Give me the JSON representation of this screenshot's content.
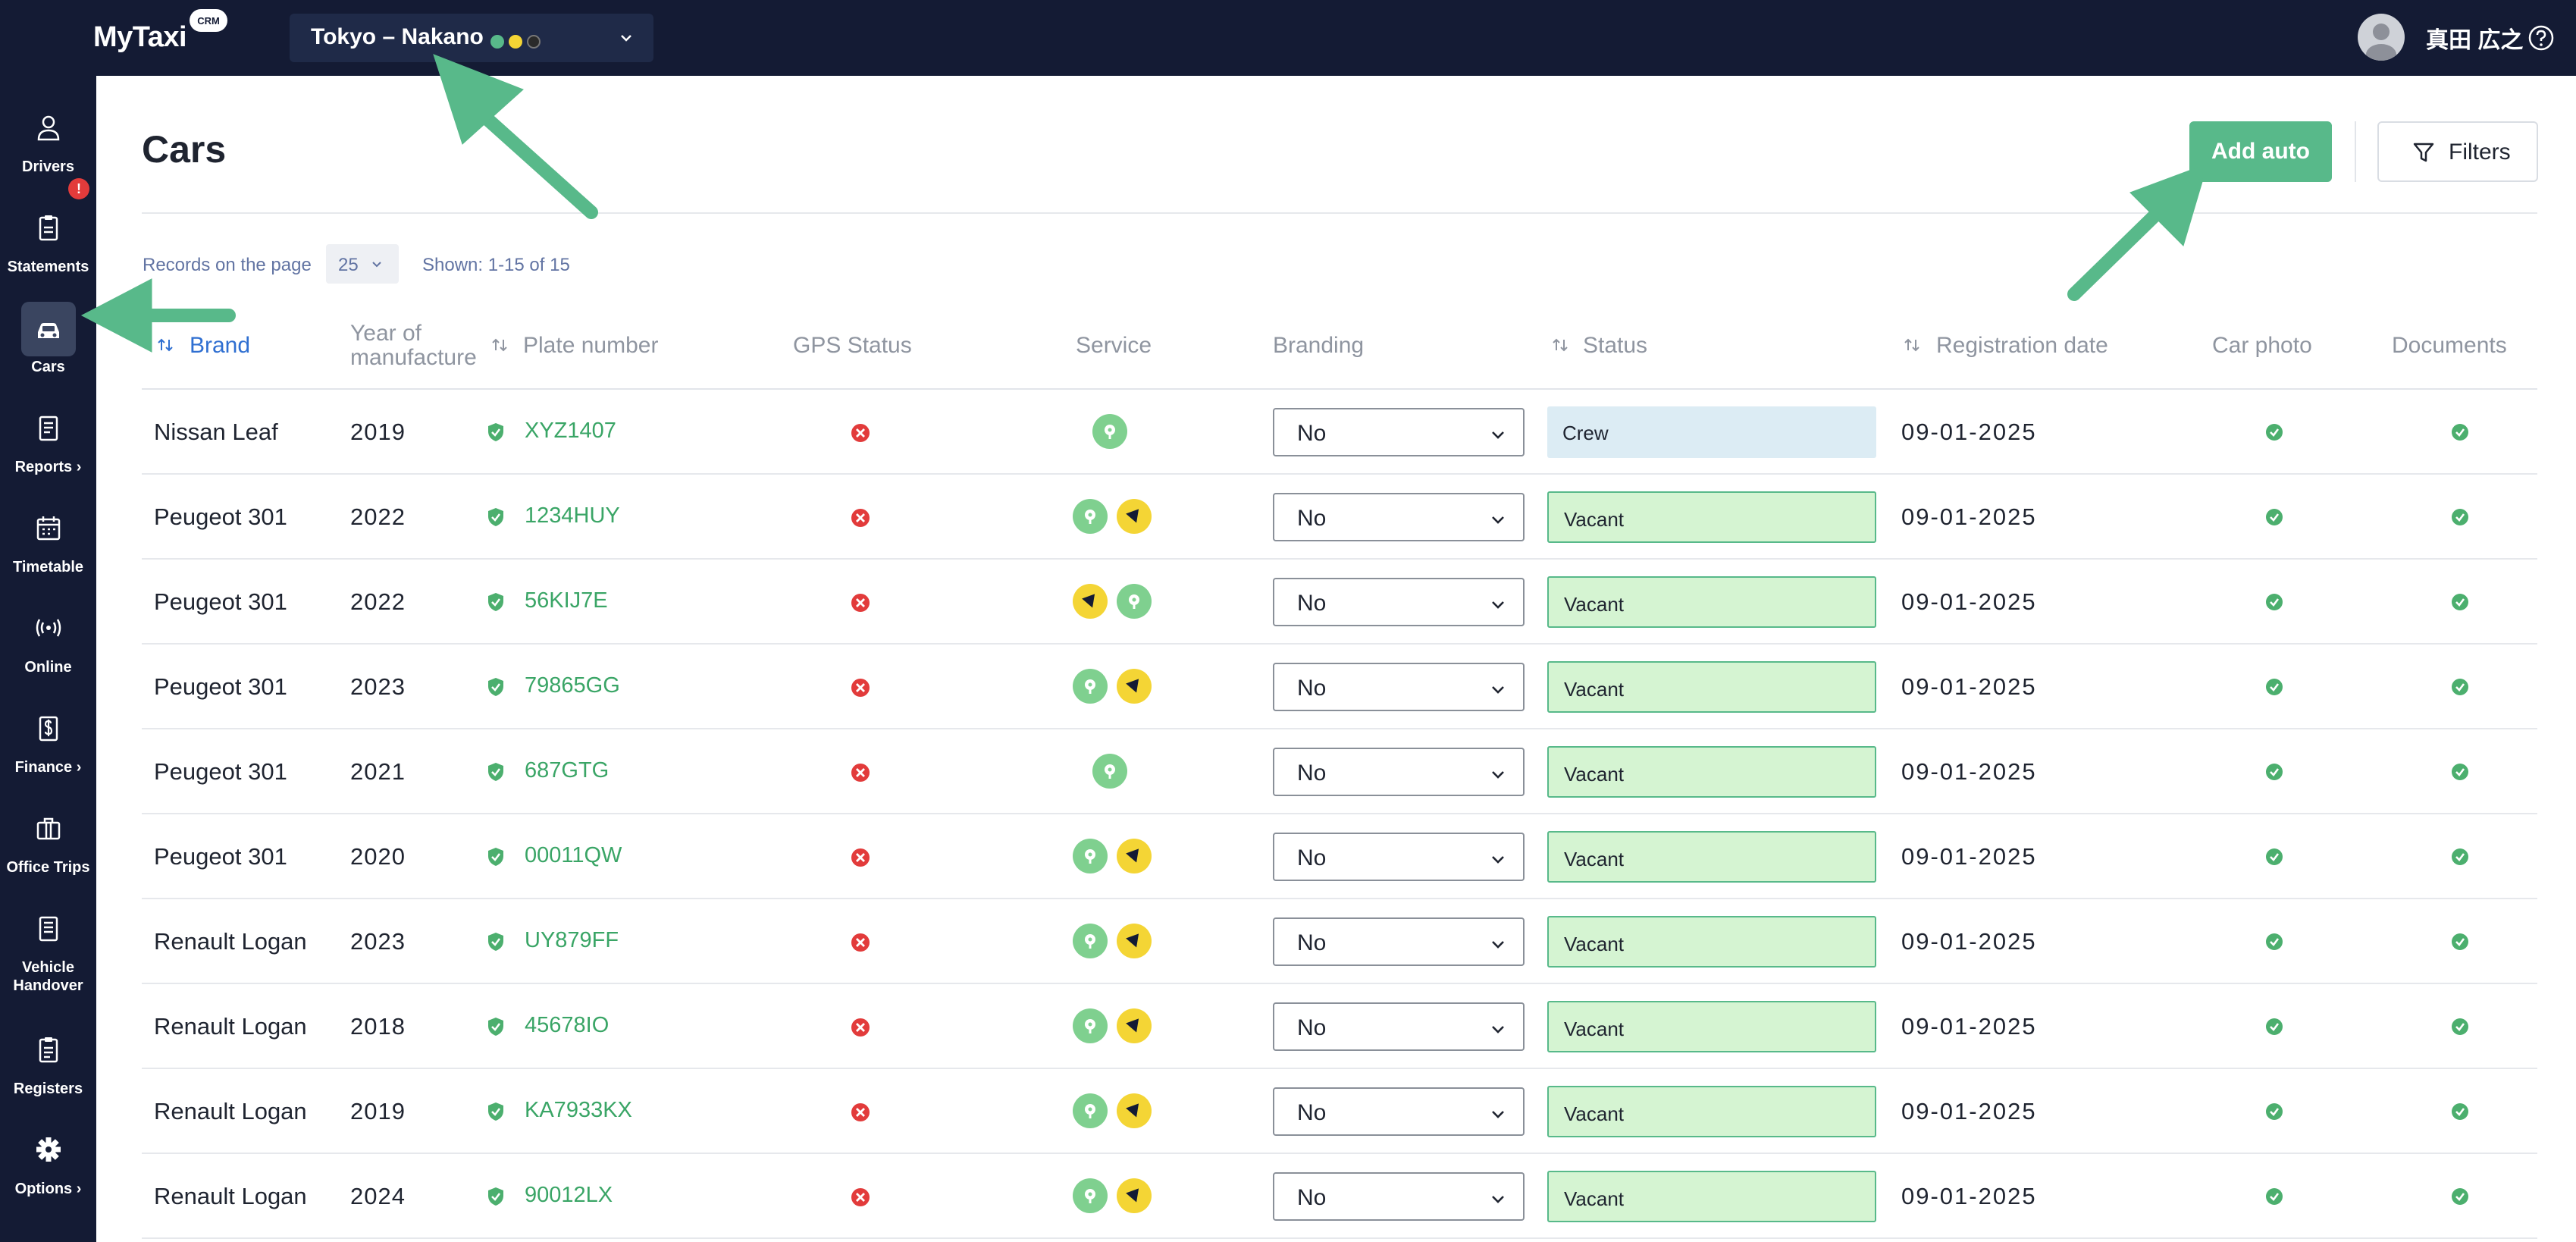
{
  "app": {
    "name": "MyTaxi",
    "badge": "CRM"
  },
  "region": {
    "label": "Tokyo – Nakano",
    "dots": [
      "#58b98a",
      "#f4d535",
      "#2a2a2a"
    ]
  },
  "user": {
    "name": "真田 広之"
  },
  "sidebar": {
    "items": [
      {
        "label": "Drivers",
        "icon": "user-icon"
      },
      {
        "label": "Statements",
        "icon": "clipboard-icon",
        "badge": "!"
      },
      {
        "label": "Cars",
        "icon": "car-icon",
        "active": true
      },
      {
        "label": "Reports ›",
        "icon": "report-icon"
      },
      {
        "label": "Timetable",
        "icon": "calendar-icon"
      },
      {
        "label": "Online",
        "icon": "broadcast-icon"
      },
      {
        "label": "Finance ›",
        "icon": "finance-icon"
      },
      {
        "label": "Office Trips",
        "icon": "briefcase-icon"
      },
      {
        "label": "Vehicle\nHandover",
        "icon": "document-icon"
      },
      {
        "label": "Registers",
        "icon": "list-icon"
      },
      {
        "label": "Options ›",
        "icon": "gear-icon"
      }
    ]
  },
  "page": {
    "title": "Cars",
    "add_button": "Add auto",
    "filters_button": "Filters",
    "records_label": "Records on the page",
    "records_value": "25",
    "shown_text": "Shown: 1-15 of 15"
  },
  "table": {
    "headers": {
      "brand": "Brand",
      "year": "Year of\nmanufacture",
      "plate": "Plate number",
      "gps": "GPS Status",
      "service": "Service",
      "branding": "Branding",
      "status": "Status",
      "registration": "Registration date",
      "photo": "Car photo",
      "documents": "Documents"
    },
    "rows": [
      {
        "brand": "Nissan Leaf",
        "year": "2019",
        "plate": "XYZ1407",
        "services": [
          "green"
        ],
        "branding": "No",
        "status": "Crew",
        "status_type": "crew",
        "reg": "09-01-2025"
      },
      {
        "brand": "Peugeot 301",
        "year": "2022",
        "plate": "1234HUY",
        "services": [
          "green",
          "yellow"
        ],
        "branding": "No",
        "status": "Vacant",
        "status_type": "vacant",
        "reg": "09-01-2025"
      },
      {
        "brand": "Peugeot 301",
        "year": "2022",
        "plate": "56KIJ7E",
        "services": [
          "yellow",
          "green"
        ],
        "branding": "No",
        "status": "Vacant",
        "status_type": "vacant",
        "reg": "09-01-2025"
      },
      {
        "brand": "Peugeot 301",
        "year": "2023",
        "plate": "79865GG",
        "services": [
          "green",
          "yellow"
        ],
        "branding": "No",
        "status": "Vacant",
        "status_type": "vacant",
        "reg": "09-01-2025"
      },
      {
        "brand": "Peugeot 301",
        "year": "2021",
        "plate": "687GTG",
        "services": [
          "green"
        ],
        "branding": "No",
        "status": "Vacant",
        "status_type": "vacant",
        "reg": "09-01-2025"
      },
      {
        "brand": "Peugeot 301",
        "year": "2020",
        "plate": "00011QW",
        "services": [
          "green",
          "yellow"
        ],
        "branding": "No",
        "status": "Vacant",
        "status_type": "vacant",
        "reg": "09-01-2025"
      },
      {
        "brand": "Renault Logan",
        "year": "2023",
        "plate": "UY879FF",
        "services": [
          "green",
          "yellow"
        ],
        "branding": "No",
        "status": "Vacant",
        "status_type": "vacant",
        "reg": "09-01-2025"
      },
      {
        "brand": "Renault Logan",
        "year": "2018",
        "plate": "45678IO",
        "services": [
          "green",
          "yellow"
        ],
        "branding": "No",
        "status": "Vacant",
        "status_type": "vacant",
        "reg": "09-01-2025"
      },
      {
        "brand": "Renault Logan",
        "year": "2019",
        "plate": "KA7933KX",
        "services": [
          "green",
          "yellow"
        ],
        "branding": "No",
        "status": "Vacant",
        "status_type": "vacant",
        "reg": "09-01-2025"
      },
      {
        "brand": "Renault Logan",
        "year": "2024",
        "plate": "90012LX",
        "services": [
          "green",
          "yellow"
        ],
        "branding": "No",
        "status": "Vacant",
        "status_type": "vacant",
        "reg": "09-01-2025"
      }
    ]
  },
  "colors": {
    "accent": "#58b98a",
    "nav_bg": "#141b34",
    "error": "#e23b3b",
    "link": "#2f6fd1"
  }
}
